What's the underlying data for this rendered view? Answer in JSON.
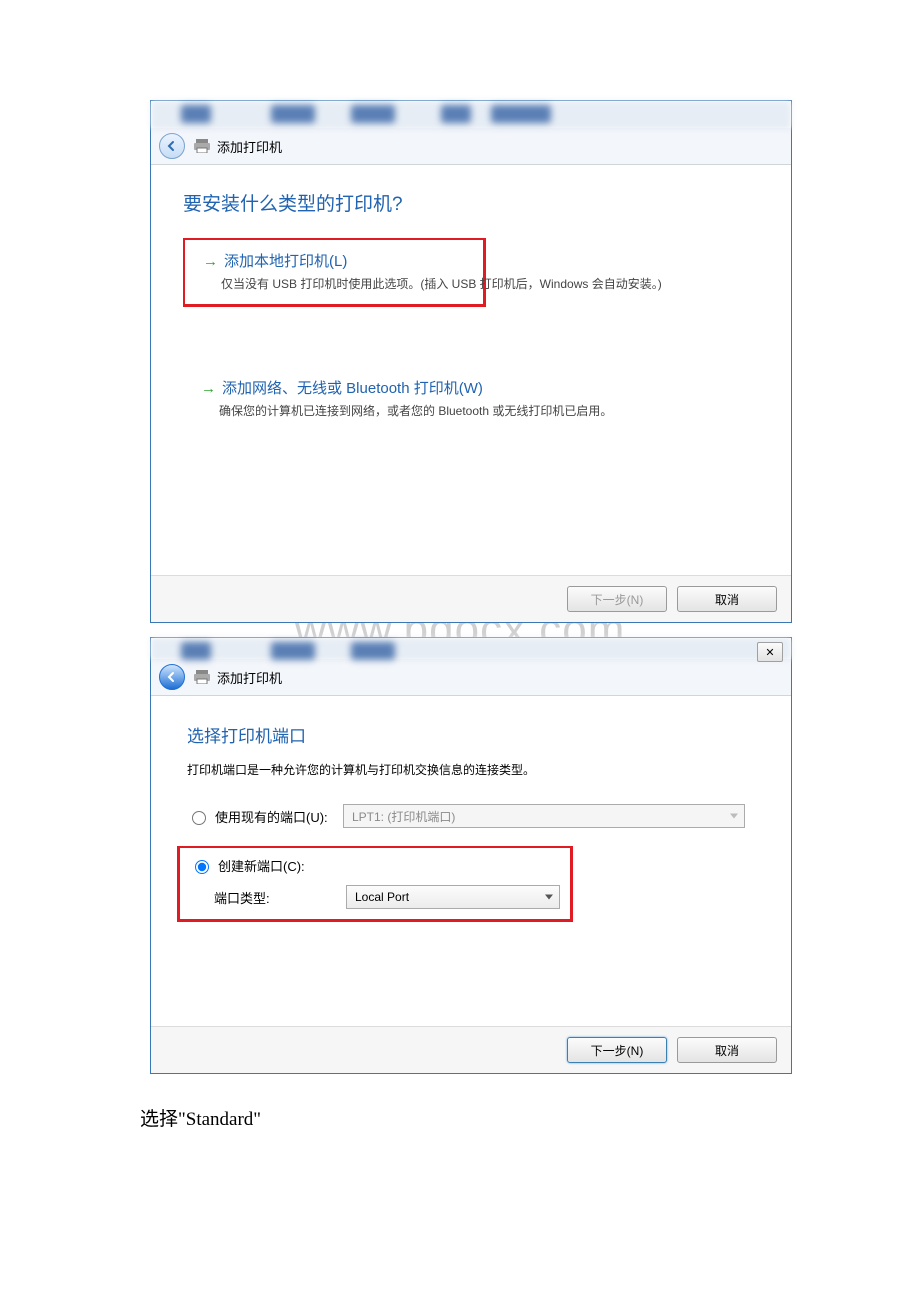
{
  "watermark": "www.bdocx.com",
  "dialog1": {
    "breadcrumb": "添加打印机",
    "question": "要安装什么类型的打印机?",
    "opt_local_title": "添加本地打印机(L)",
    "opt_local_desc": "仅当没有 USB 打印机时使用此选项。(插入 USB 打印机后，Windows 会自动安装。)",
    "opt_net_title": "添加网络、无线或 Bluetooth 打印机(W)",
    "opt_net_desc": "确保您的计算机已连接到网络，或者您的 Bluetooth 或无线打印机已启用。",
    "next": "下一步(N)",
    "cancel": "取消"
  },
  "dialog2": {
    "breadcrumb": "添加打印机",
    "close": "✕",
    "title": "选择打印机端口",
    "desc": "打印机端口是一种允许您的计算机与打印机交换信息的连接类型。",
    "use_existing": "使用现有的端口(U):",
    "existing_value": "LPT1: (打印机端口)",
    "create_new": "创建新端口(C):",
    "port_type_label": "端口类型:",
    "port_type_value": "Local Port",
    "next": "下一步(N)",
    "cancel": "取消"
  },
  "caption": "选择\"Standard\""
}
